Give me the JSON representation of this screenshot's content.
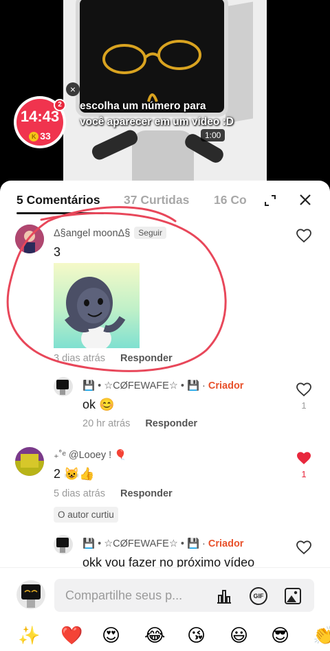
{
  "video": {
    "caption_line1": "escolha um número para",
    "caption_line2": "você aparecer em um vídeo :D",
    "duration": "1:00",
    "close_icon": "close-icon"
  },
  "timer": {
    "time": "14:43",
    "coins": "33",
    "coin_letter": "K",
    "badge": "2",
    "color": "#f0344e"
  },
  "tabs": [
    {
      "label": "5 Comentários",
      "active": true
    },
    {
      "label": "37 Curtidas",
      "active": false
    },
    {
      "label": "16 Co",
      "active": false
    }
  ],
  "comments": [
    {
      "author": "Δ§angel moonΔ§",
      "follow_label": "Seguir",
      "text": "3",
      "time": "3 dias atrás",
      "reply_label": "Responder",
      "liked": false,
      "likes": ""
    },
    {
      "author": "💾 • ☆CØFEWAFE☆ • 💾 ·",
      "creator_label": "Criador",
      "text": "ok 😊",
      "time": "20 hr atrás",
      "reply_label": "Responder",
      "liked": false,
      "likes": "1"
    },
    {
      "author": "₊˚ᵉ @Looey ! 🎈",
      "text": "2 😺👍",
      "time": "5 dias atrás",
      "reply_label": "Responder",
      "author_liked_label": "O autor curtiu",
      "liked": true,
      "likes": "1"
    },
    {
      "author": "💾 • ☆CØFEWAFE☆ • 💾 ·",
      "creator_label": "Criador",
      "text": "okk vou fazer no próximo vídeo",
      "liked": false
    }
  ],
  "composer": {
    "placeholder": "Compartilhe seus p...",
    "gif_label": "GIF"
  },
  "emojis": [
    "✨",
    "❤️",
    "😍",
    "😂",
    "😘",
    "😃",
    "😎",
    "👏"
  ],
  "colors": {
    "like_red": "#e8283d",
    "creator_orange": "#e8512b",
    "annotation_red": "#e8475a"
  }
}
